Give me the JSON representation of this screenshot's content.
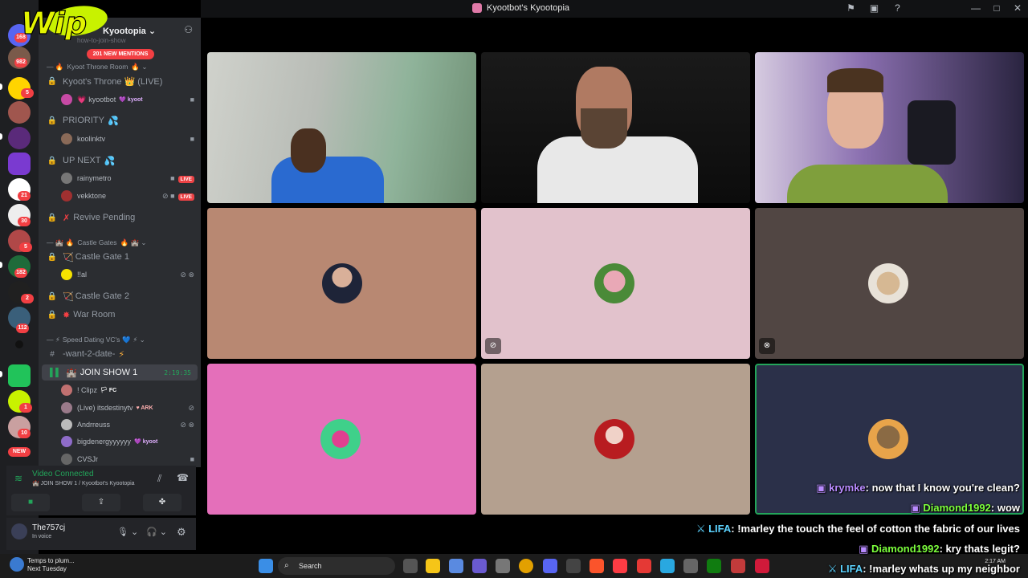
{
  "window": {
    "title": "Kyootbot's Kyootopia"
  },
  "overlay_logo": "WIP",
  "server": {
    "name": "Kyootopia",
    "mentions": "201 NEW MENTIONS"
  },
  "rail_badges": [
    "168",
    "982",
    "5",
    "21",
    "30",
    "5",
    "182",
    "2",
    "112",
    "1",
    "10",
    "NEW"
  ],
  "channels": {
    "top_faded": "how-to-join-show",
    "cat_throne": "Kyoot Throne Room",
    "throne": "Kyoot's Throne 👑 (LIVE)",
    "throne_user": "kyootbot",
    "throne_user_tag": "kyoot",
    "priority": "PRIORITY",
    "priority_user": "koolinktv",
    "upnext": "UP NEXT",
    "upnext_users": [
      "rainymetro",
      "vekktone"
    ],
    "live_label": "LIVE",
    "revive": "Revive Pending",
    "cat_castle": "Castle Gates",
    "castle1": "Castle Gate 1",
    "castle1_user": "!!al",
    "castle2": "Castle Gate 2",
    "war": "War Room",
    "cat_speed": "Speed Dating VC's",
    "want2date": "-want-2-date-",
    "joinshow": "JOIN SHOW 1",
    "joinshow_timer": "2:19:35",
    "joinshow_users": [
      {
        "name": "! Clipz",
        "tag": "FC"
      },
      {
        "name": "(Live) itsdestinytv",
        "tag": "ARK"
      },
      {
        "name": "Andrreuss",
        "tag": ""
      },
      {
        "name": "bigdenergyyyyyy",
        "tag": "kyoot"
      },
      {
        "name": "CVSJr",
        "tag": ""
      }
    ]
  },
  "voice": {
    "status": "Video Connected",
    "channel": "JOIN SHOW 1 / Kyootbot's Kyootopia"
  },
  "user": {
    "name": "The757cj",
    "status": "In voice"
  },
  "chat": [
    {
      "name": "krymke",
      "text": ": now that I know you're clean?",
      "color": "#b98bff"
    },
    {
      "name": "Diamond1992",
      "text": ": wow",
      "color": "#7cff3c"
    },
    {
      "name": "LIFA",
      "text": ": !marley the touch the feel of cotton the fabric of our lives",
      "color": "#5cd3ff"
    },
    {
      "name": "Diamond1992",
      "text": ": kry thats legit?",
      "color": "#7cff3c"
    },
    {
      "name": "LIFA",
      "text": ": !marley whats up my neighbor",
      "color": "#5cd3ff"
    }
  ],
  "taskbar": {
    "search": "Search",
    "weather_line1": "Temps to plum...",
    "weather_line2": "Next Tuesday",
    "time": "2:17 AM",
    "date": ""
  }
}
